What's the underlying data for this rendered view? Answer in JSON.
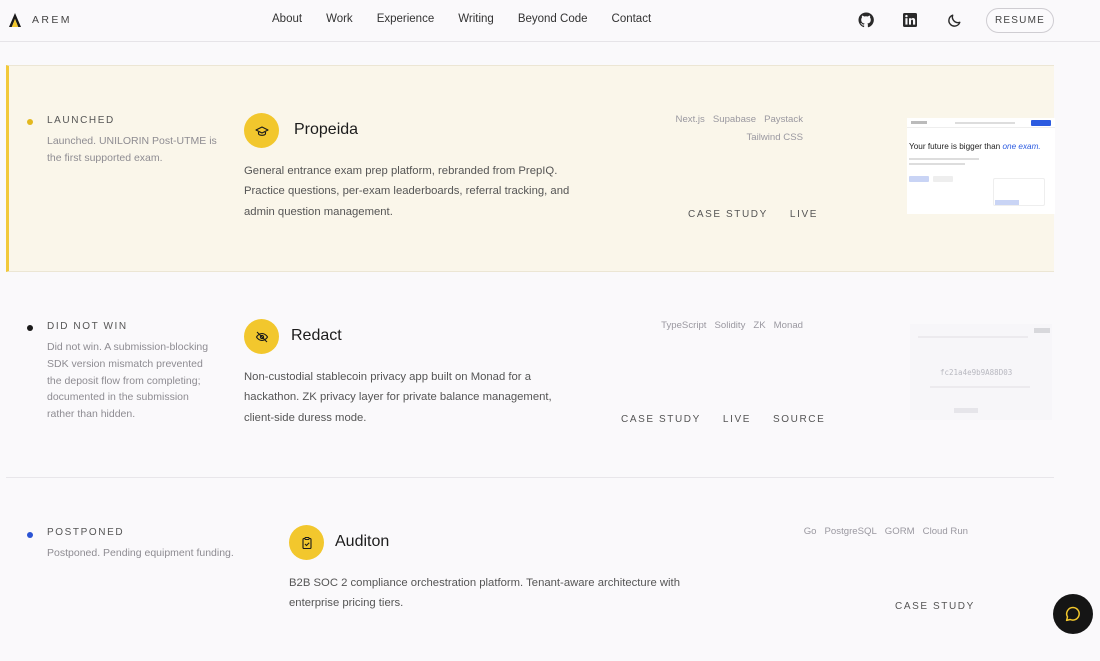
{
  "brand": {
    "name": "AREM"
  },
  "nav": {
    "links": [
      "About",
      "Work",
      "Experience",
      "Writing",
      "Beyond Code",
      "Contact"
    ],
    "icons": [
      "github-icon",
      "linkedin-icon",
      "moon-icon"
    ],
    "resume_label": "RESUME"
  },
  "projects": [
    {
      "status": "LAUNCHED",
      "status_color": "#e3b81f",
      "note": "Launched. UNILORIN Post-UTME is the first supported exam.",
      "icon": "graduation-cap-icon",
      "title": "Propeida",
      "description": "General entrance exam prep platform, rebranded from PrepIQ. Practice questions, per-exam leaderboards, referral tracking, and admin question management.",
      "tags": [
        "Next.js",
        "Supabase",
        "Paystack",
        "Tailwind CSS"
      ],
      "links": [
        "CASE STUDY",
        "LIVE"
      ],
      "thumb": {
        "headline_a": "Your future is bigger than ",
        "headline_b": "one exam."
      }
    },
    {
      "status": "DID NOT WIN",
      "status_color": "#1a1a1a",
      "note": "Did not win. A submission-blocking SDK version mismatch prevented the deposit flow from completing; documented in the submission rather than hidden.",
      "icon": "eye-off-icon",
      "title": "Redact",
      "description": "Non-custodial stablecoin privacy app built on Monad for a hackathon. ZK privacy layer for private balance management, client-side duress mode.",
      "tags": [
        "TypeScript",
        "Solidity",
        "ZK",
        "Monad"
      ],
      "links": [
        "CASE STUDY",
        "LIVE",
        "SOURCE"
      ],
      "thumb": {
        "hash": "fc21a4e9b9A88D03"
      }
    },
    {
      "status": "POSTPONED",
      "status_color": "#2b54d4",
      "note": "Postponed. Pending equipment funding.",
      "icon": "clipboard-check-icon",
      "title": "Auditon",
      "description": "B2B SOC 2 compliance orchestration platform. Tenant-aware architecture with enterprise pricing tiers.",
      "tags": [
        "Go",
        "PostgreSQL",
        "GORM",
        "Cloud Run"
      ],
      "links": [
        "CASE STUDY"
      ]
    }
  ],
  "colors": {
    "accent": "#f2c72d",
    "launched_bg": "#faf6ea",
    "dark": "#151515"
  }
}
